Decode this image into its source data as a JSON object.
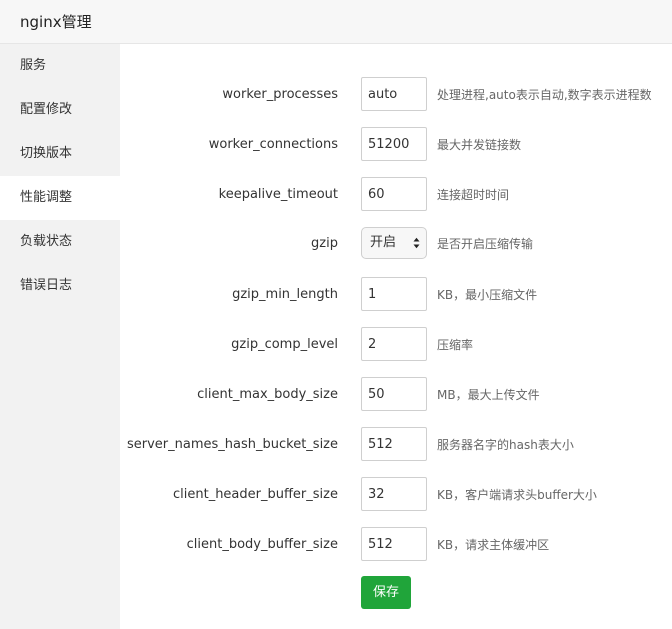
{
  "header": {
    "title": "nginx管理"
  },
  "sidebar": {
    "items": [
      {
        "label": "服务"
      },
      {
        "label": "配置修改"
      },
      {
        "label": "切换版本"
      },
      {
        "label": "性能调整"
      },
      {
        "label": "负载状态"
      },
      {
        "label": "错误日志"
      }
    ]
  },
  "form": {
    "rows": [
      {
        "label": "worker_processes",
        "value": "auto",
        "desc": "处理进程,auto表示自动,数字表示进程数"
      },
      {
        "label": "worker_connections",
        "value": "51200",
        "desc": "最大并发链接数"
      },
      {
        "label": "keepalive_timeout",
        "value": "60",
        "desc": "连接超时时间"
      },
      {
        "label": "gzip",
        "value": "开启",
        "desc": "是否开启压缩传输"
      },
      {
        "label": "gzip_min_length",
        "value": "1",
        "desc": "KB，最小压缩文件"
      },
      {
        "label": "gzip_comp_level",
        "value": "2",
        "desc": "压缩率"
      },
      {
        "label": "client_max_body_size",
        "value": "50",
        "desc": "MB，最大上传文件"
      },
      {
        "label": "server_names_hash_bucket_size",
        "value": "512",
        "desc": "服务器名字的hash表大小"
      },
      {
        "label": "client_header_buffer_size",
        "value": "32",
        "desc": "KB，客户端请求头buffer大小"
      },
      {
        "label": "client_body_buffer_size",
        "value": "512",
        "desc": "KB，请求主体缓冲区"
      }
    ],
    "save_label": "保存"
  }
}
